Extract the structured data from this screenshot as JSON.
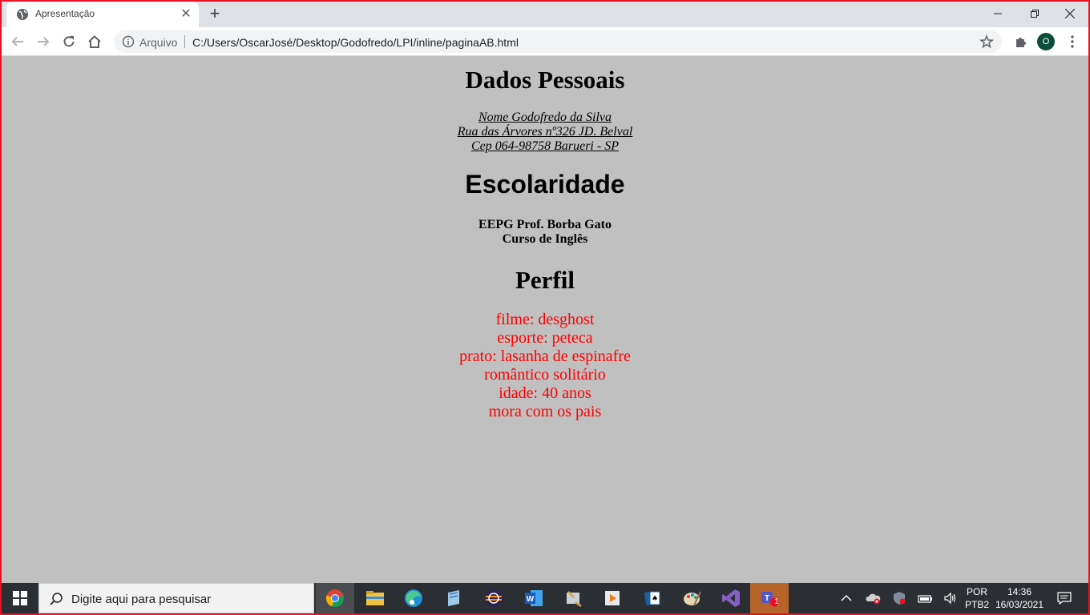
{
  "browser": {
    "tab_title": "Apresentação",
    "tab_close": "✕",
    "new_tab": "+",
    "scheme_label": "Arquivo",
    "url": "C:/Users/OscarJosé/Desktop/Godofredo/LPI/inline/paginaAB.html",
    "profile_initial": "O"
  },
  "page": {
    "heading_dados": "Dados Pessoais",
    "address": [
      "Nome Godofredo da Silva",
      "Rua das Árvores nº326 JD. Belval",
      "Cep 064-98758 Barueri - SP"
    ],
    "heading_escolaridade": "Escolaridade",
    "schooling": [
      "EEPG Prof. Borba Gato",
      "Curso de Inglês"
    ],
    "heading_perfil": "Perfil",
    "profile": [
      "filme: desghost",
      "esporte: peteca",
      "prato: lasanha de espinafre",
      "romântico solitário",
      "idade: 40 anos",
      "mora com os pais"
    ],
    "profile_color": "#ff0000",
    "background": "#c0c0c0"
  },
  "taskbar": {
    "search_placeholder": "Digite aqui para pesquisar",
    "teams_badge": "1",
    "lang_top": "POR",
    "lang_bottom": "PTB2",
    "time": "14:36",
    "date": "16/03/2021"
  }
}
